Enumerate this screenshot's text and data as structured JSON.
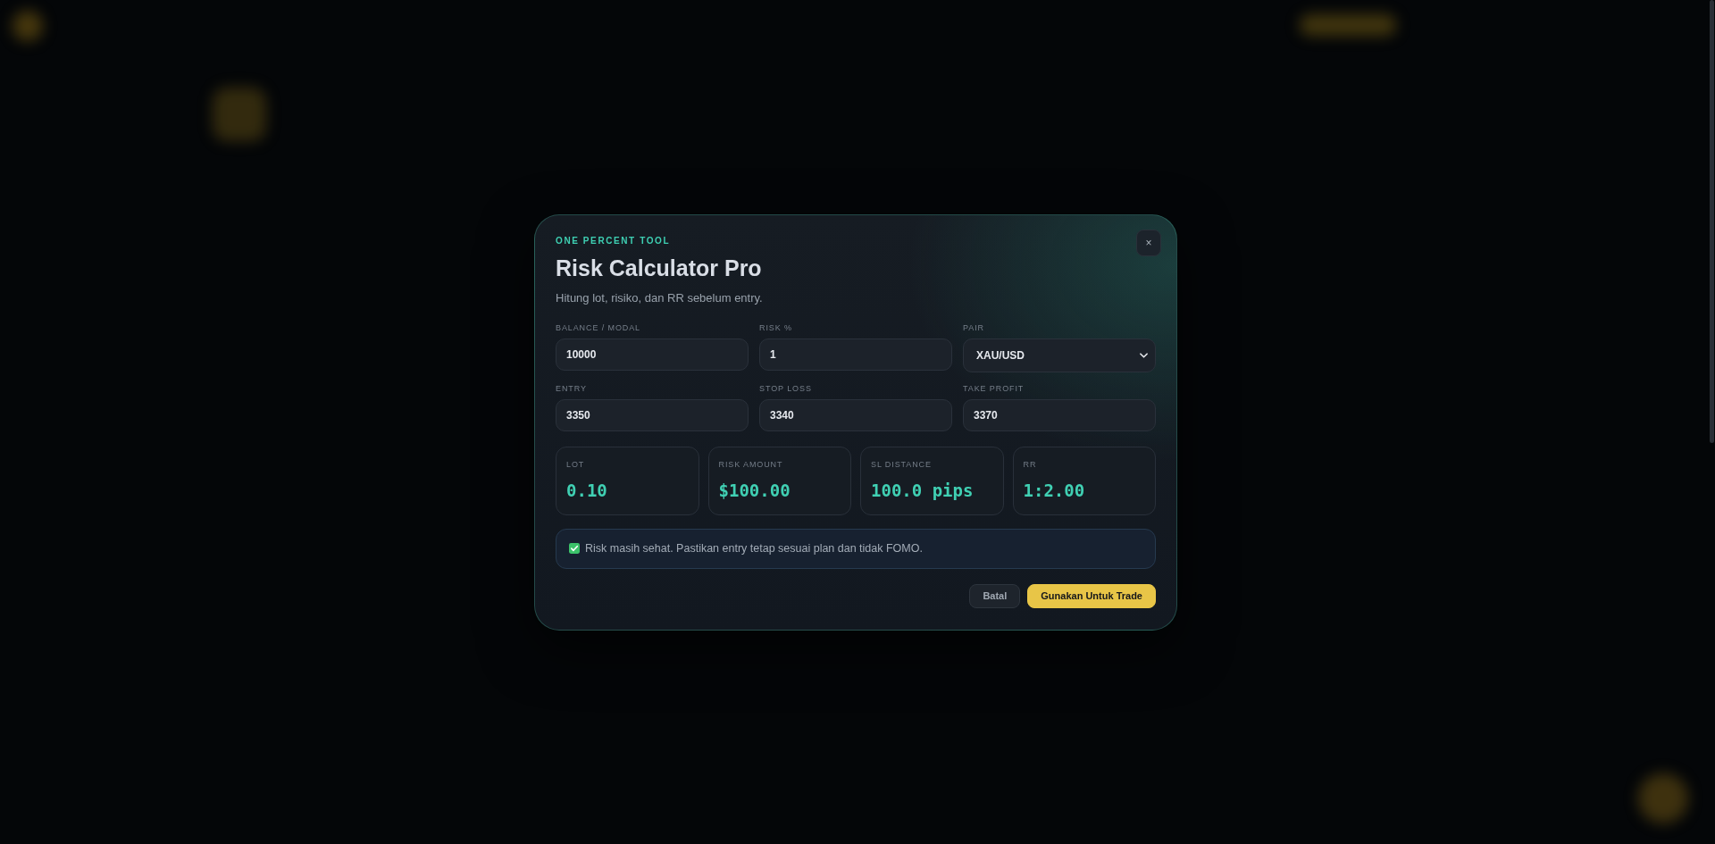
{
  "modal": {
    "eyebrow": "ONE PERCENT TOOL",
    "title": "Risk Calculator Pro",
    "subtitle": "Hitung lot, risiko, dan RR sebelum entry.",
    "close": "×",
    "fields": [
      {
        "label": "BALANCE / MODAL",
        "kind": "input",
        "value": "10000"
      },
      {
        "label": "RISK %",
        "kind": "input",
        "value": "1"
      },
      {
        "label": "PAIR",
        "kind": "select",
        "value": "XAU/USD"
      },
      {
        "label": "ENTRY",
        "kind": "input",
        "value": "3350"
      },
      {
        "label": "STOP LOSS",
        "kind": "input",
        "value": "3340"
      },
      {
        "label": "TAKE PROFIT",
        "kind": "input",
        "value": "3370"
      }
    ],
    "results": [
      {
        "label": "LOT",
        "value": "0.10"
      },
      {
        "label": "RISK AMOUNT",
        "value": "$100.00"
      },
      {
        "label": "SL DISTANCE",
        "value": "100.0 pips"
      },
      {
        "label": "RR",
        "value": "1:2.00"
      }
    ],
    "notice": {
      "text": "Risk masih sehat. Pastikan entry tetap sesuai plan dan tidak FOMO."
    },
    "buttons": [
      {
        "label": "Batal",
        "kind": "secondary"
      },
      {
        "label": "Gunakan Untuk Trade",
        "kind": "primary"
      }
    ]
  }
}
